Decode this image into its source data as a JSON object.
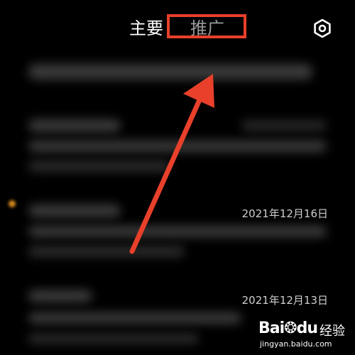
{
  "header": {
    "tabs": [
      {
        "label": "主要"
      },
      {
        "label": "推广"
      }
    ],
    "settings_icon": "gear-icon",
    "highlight_color": "#e8402b"
  },
  "messages": [
    {
      "date": ""
    },
    {
      "date": ""
    },
    {
      "date": "2021年12月16日"
    },
    {
      "date": "2021年12月13日"
    }
  ],
  "annotation": {
    "arrow_color": "#e8402b"
  },
  "watermark": {
    "brand": "Bai",
    "brand_tail": "du",
    "product": "经验",
    "url": "jingyan.baidu.com"
  }
}
